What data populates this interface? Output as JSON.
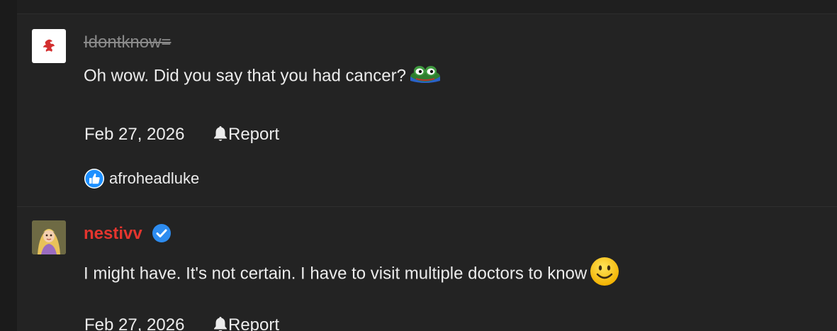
{
  "comments": [
    {
      "username": "Idontknow=",
      "message": "Oh wow. Did you say that you had cancer?",
      "emoji": "peepo-frog-icon",
      "date": "Feb 27, 2026",
      "report_label": "Report",
      "reactions": [
        {
          "icon": "thumbs-up-icon",
          "user": "afroheadluke"
        }
      ]
    },
    {
      "username": "nestivv",
      "verified": true,
      "message": "I might have. It's not certain. I have to visit multiple doctors to know",
      "emoji": "smiley-face-icon",
      "date": "Feb 27, 2026",
      "report_label": "Report"
    }
  ],
  "colors": {
    "background": "#232323",
    "text": "#ececec",
    "muted_username": "#8a8a8a",
    "highlight_username": "#e5352e",
    "verified_badge": "#2d8cf0",
    "like_reaction": "#1e90ff"
  }
}
